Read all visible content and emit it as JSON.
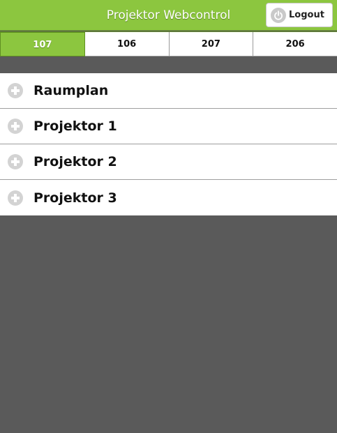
{
  "header": {
    "title": "Projektor Webcontrol",
    "logout_label": "Logout",
    "logout_icon": "power-icon"
  },
  "tabs": [
    {
      "label": "107",
      "active": true
    },
    {
      "label": "106",
      "active": false
    },
    {
      "label": "207",
      "active": false
    },
    {
      "label": "206",
      "active": false
    }
  ],
  "list": {
    "items": [
      {
        "label": "Raumplan",
        "icon": "plus-circle-icon"
      },
      {
        "label": "Projektor 1",
        "icon": "plus-circle-icon"
      },
      {
        "label": "Projektor 2",
        "icon": "plus-circle-icon"
      },
      {
        "label": "Projektor 3",
        "icon": "plus-circle-icon"
      }
    ]
  },
  "colors": {
    "accent": "#8cc63f",
    "background": "#5a5a5a"
  }
}
